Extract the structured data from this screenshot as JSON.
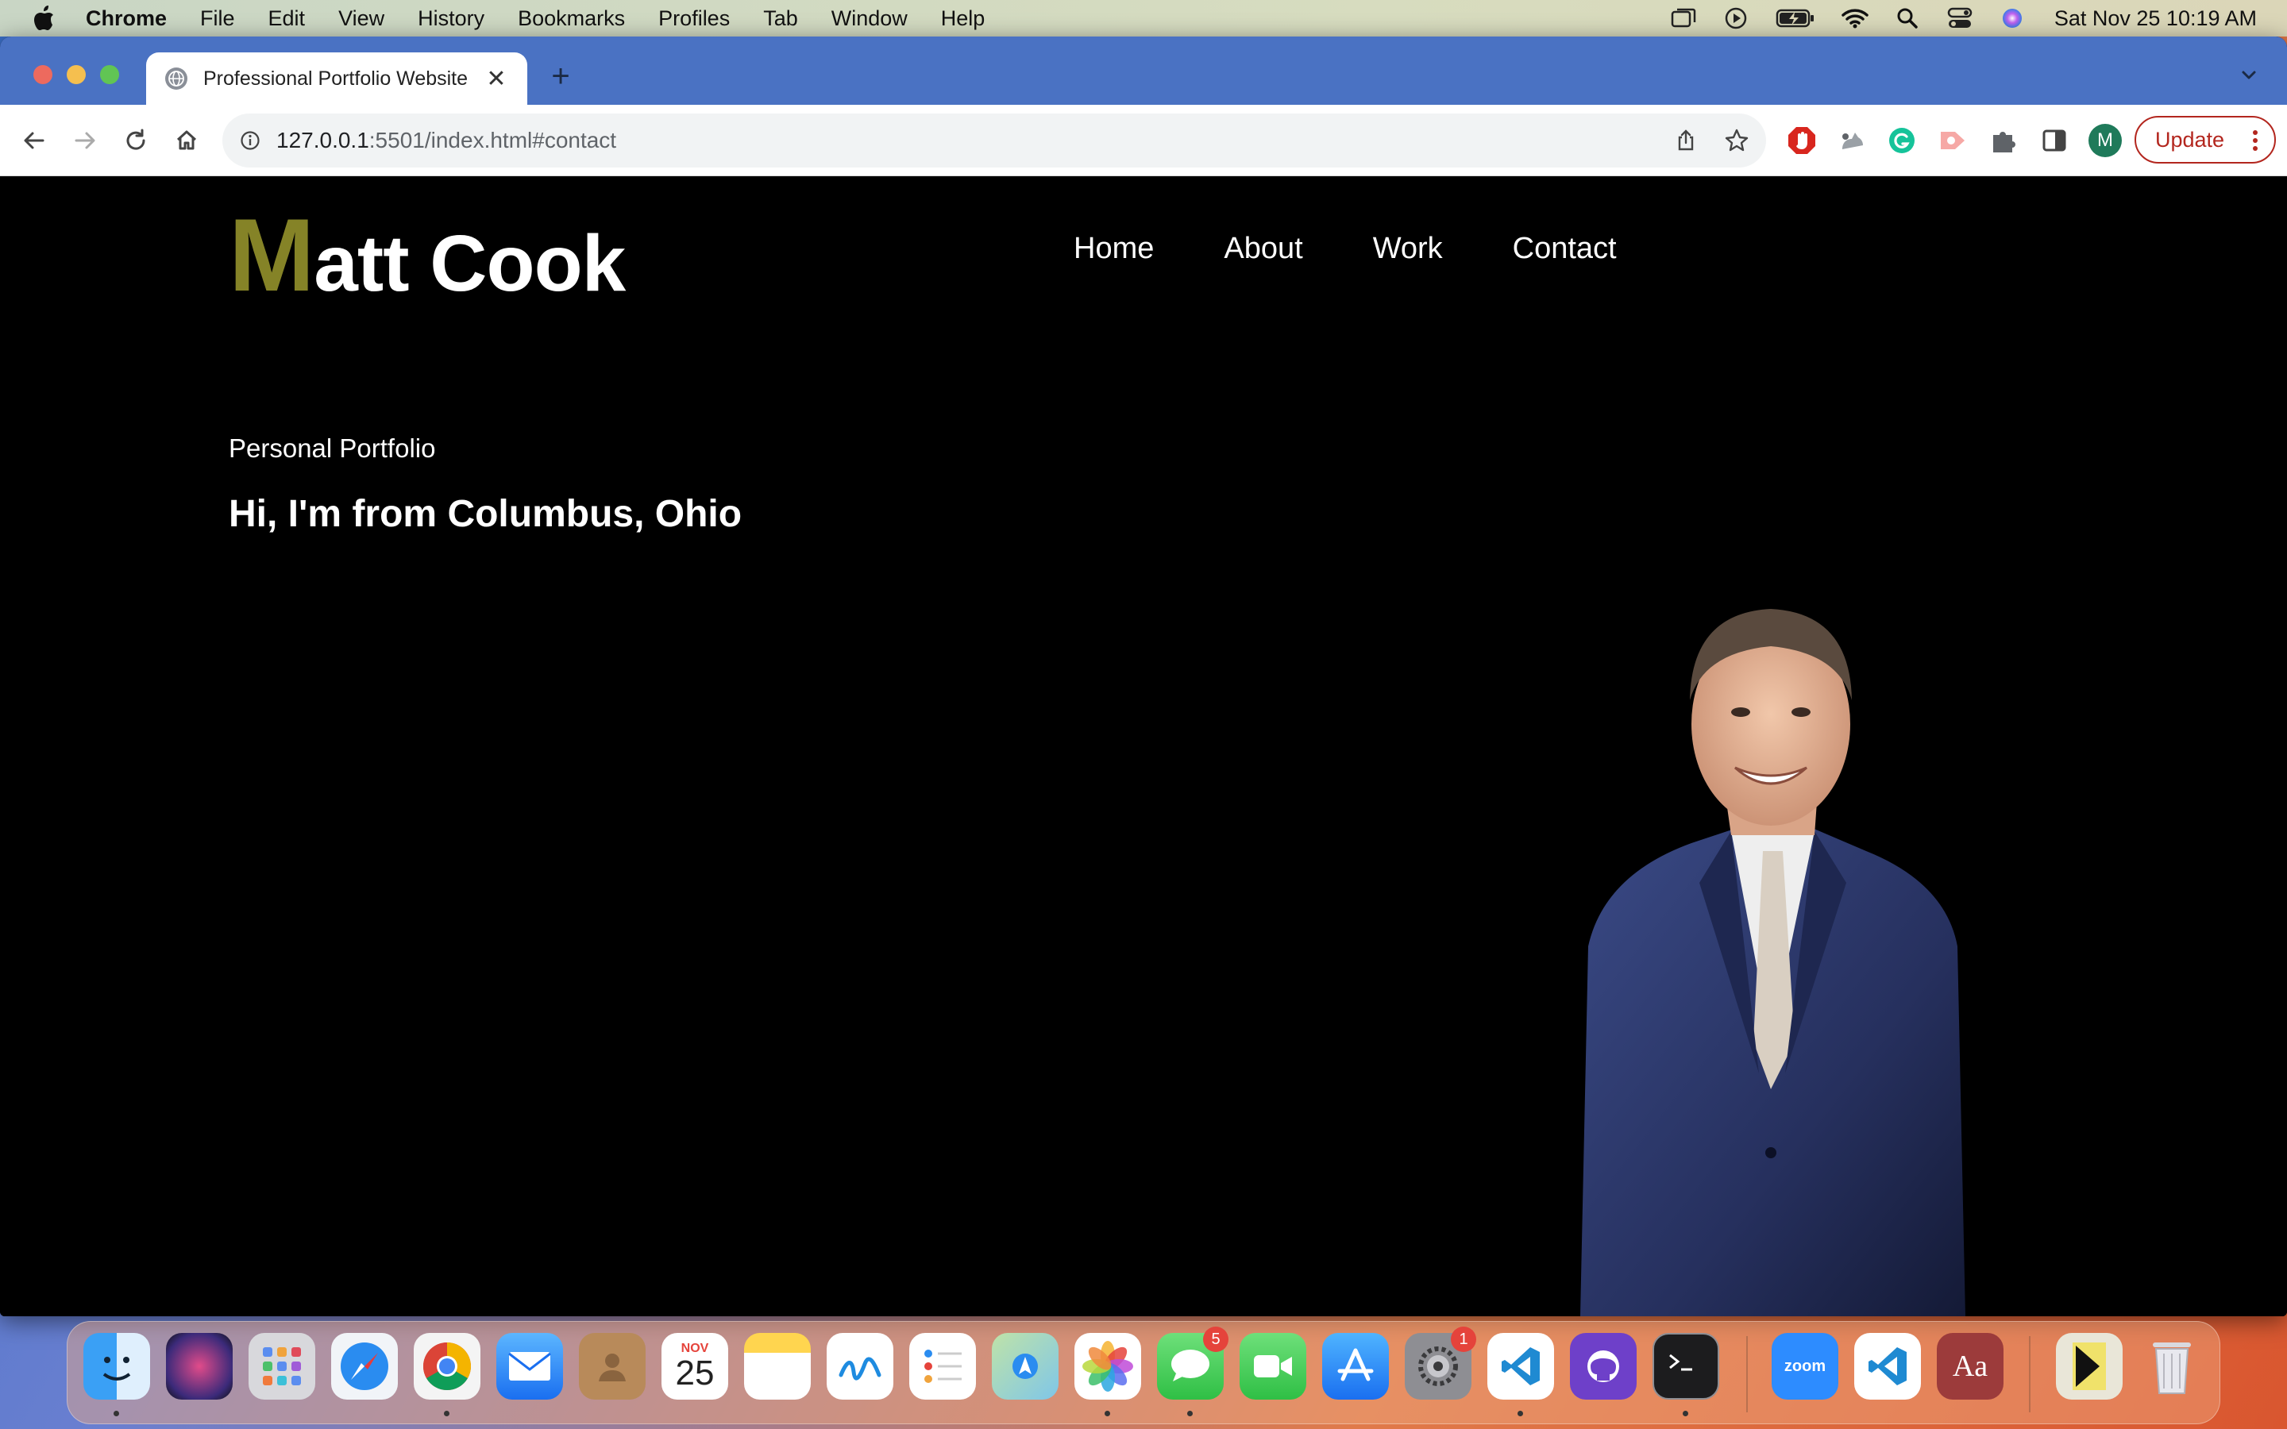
{
  "menubar": {
    "app_name": "Chrome",
    "items": [
      "File",
      "Edit",
      "View",
      "History",
      "Bookmarks",
      "Profiles",
      "Tab",
      "Window",
      "Help"
    ],
    "clock": "Sat Nov 25  10:19 AM",
    "status_icons": [
      "window-icon",
      "play-icon",
      "battery-charging-icon",
      "wifi-icon",
      "spotlight-search-icon",
      "control-center-icon",
      "siri-icon"
    ]
  },
  "browser": {
    "tab_title": "Professional Portfolio Website",
    "tab_close": "✕",
    "new_tab": "+",
    "url_host": "127.0.0.1",
    "url_rest": ":5501/index.html#contact",
    "profile_initial": "M",
    "update_label": "Update"
  },
  "site": {
    "logo_first": "M",
    "logo_rest": "att Cook",
    "nav": [
      "Home",
      "About",
      "Work",
      "Contact"
    ],
    "subtitle": "Personal Portfolio",
    "headline": "Hi, I'm from Columbus, Ohio"
  },
  "dock": {
    "calendar_month": "NOV",
    "calendar_day": "25",
    "messages_badge": "5",
    "settings_badge": "1",
    "zoom_label": "zoom",
    "dictionary_label": "Aa"
  },
  "colors": {
    "logo_accent": "#858327",
    "tabstrip": "#4a72c3",
    "page_bg": "#000000",
    "update_red": "#b3261e"
  }
}
